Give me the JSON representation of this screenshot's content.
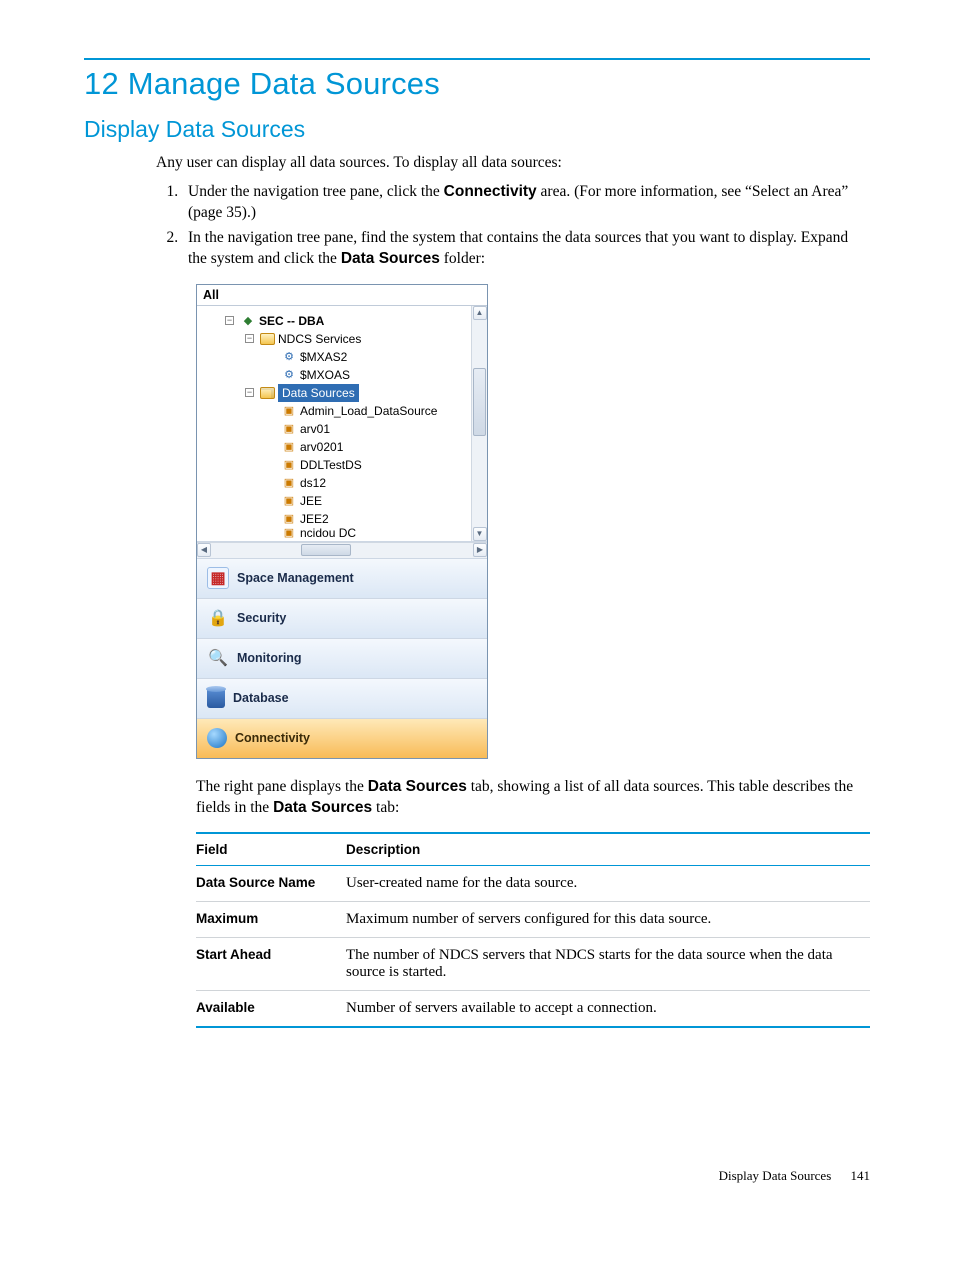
{
  "doc": {
    "chapter_title": "12 Manage Data Sources",
    "section_title": "Display Data Sources",
    "intro": "Any user can display all data sources. To display all data sources:",
    "step1_a": "Under the navigation tree pane, click the ",
    "step1_bold": "Connectivity",
    "step1_b": " area. (For more information, see “Select an Area” (page 35).)",
    "step2_a": "In the navigation tree pane, find the system that contains the data sources that you want to display. Expand the system and click the ",
    "step2_bold": "Data Sources",
    "step2_b": " folder:",
    "after_a": "The right pane displays the ",
    "after_bold1": "Data Sources",
    "after_b": " tab, showing a list of all data sources. This table describes the fields in the ",
    "after_bold2": "Data Sources",
    "after_c": " tab:",
    "footer_label": "Display Data Sources",
    "footer_page": "141"
  },
  "tree": {
    "header": "All",
    "root": "SEC -- DBA",
    "ndcs": "NDCS Services",
    "svc1": "$MXAS2",
    "svc2": "$MXOAS",
    "ds_folder": "Data Sources",
    "items": [
      "Admin_Load_DataSource",
      "arv01",
      "arv0201",
      "DDLTestDS",
      "ds12",
      "JEE",
      "JEE2",
      "ncidou DC"
    ]
  },
  "areas": {
    "space": "Space Management",
    "security": "Security",
    "monitoring": "Monitoring",
    "database": "Database",
    "connectivity": "Connectivity"
  },
  "table": {
    "h_field": "Field",
    "h_desc": "Description",
    "rows": [
      {
        "f": "Data Source Name",
        "d": "User-created name for the data source."
      },
      {
        "f": "Maximum",
        "d": "Maximum number of servers configured for this data source."
      },
      {
        "f": "Start Ahead",
        "d": "The number of NDCS servers that NDCS starts for the data source when the data source is started."
      },
      {
        "f": "Available",
        "d": "Number of servers available to accept a connection."
      }
    ]
  }
}
